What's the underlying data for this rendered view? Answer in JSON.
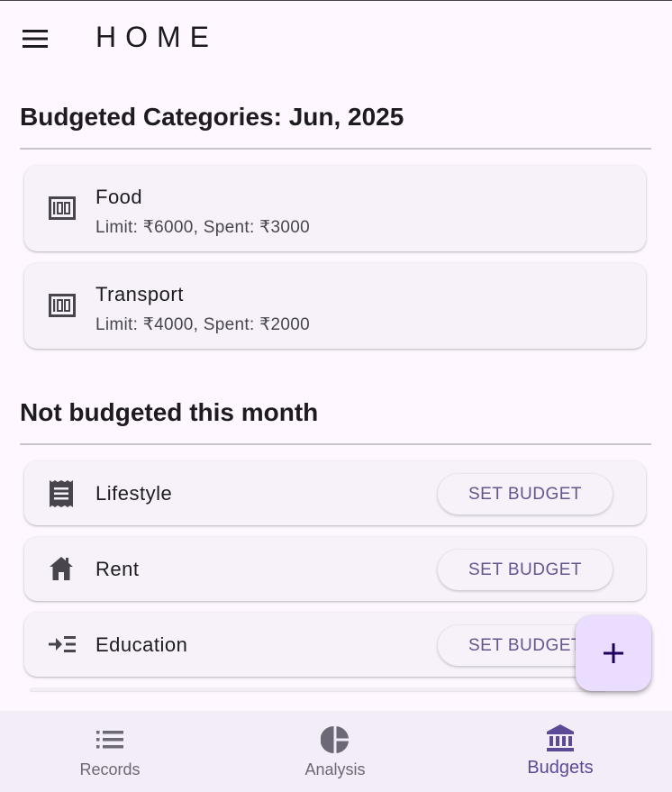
{
  "appbar": {
    "title": "HOME",
    "menu_icon": "menu-icon"
  },
  "budgeted": {
    "title": "Budgeted Categories: Jun, 2025",
    "items": [
      {
        "name": "Food",
        "detail": "Limit: ₹6000, Spent: ₹3000",
        "icon": "money-icon"
      },
      {
        "name": "Transport",
        "detail": "Limit: ₹4000, Spent: ₹2000",
        "icon": "money-icon"
      }
    ]
  },
  "not_budgeted": {
    "title": "Not budgeted this month",
    "button_label": "SET BUDGET",
    "items": [
      {
        "name": "Lifestyle",
        "icon": "receipt-icon"
      },
      {
        "name": "Rent",
        "icon": "house-icon"
      },
      {
        "name": "Education",
        "icon": "indent-list-icon"
      }
    ]
  },
  "fab": {
    "icon": "plus-icon"
  },
  "nav": {
    "items": [
      {
        "label": "Records",
        "icon": "list-icon",
        "active": false
      },
      {
        "label": "Analysis",
        "icon": "pie-chart-icon",
        "active": false
      },
      {
        "label": "Budgets",
        "icon": "bank-icon",
        "active": true
      }
    ]
  },
  "colors": {
    "background": "#fef7ff",
    "card": "#f7f2fa",
    "accent": "#65558f",
    "fab": "#eaddff",
    "navbar": "#f3edf7"
  }
}
